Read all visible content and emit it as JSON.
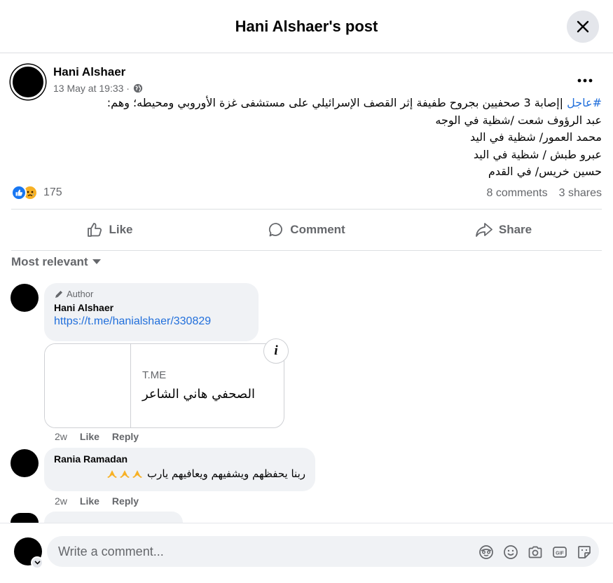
{
  "header": {
    "title": "Hani Alshaer's post"
  },
  "post": {
    "author": "Hani Alshaer",
    "timestamp": "13 May at 19:33 ·",
    "hashtag": "#عاجل",
    "line1": " |إصابة 3 صحفيين بجروح طفيفة إثر القصف الإسرائيلي على مستشفى غزة الأوروبي ومحيطه؛ وهم:",
    "line2": "عبد الرؤوف شعت /شظية في الوجه",
    "line3": "محمد العمور/ شظية في اليد",
    "line4": "عبرو طبش / شظية في اليد",
    "line5": "حسين خريس/ في القدم",
    "reaction_count": "175",
    "comments": "8 comments",
    "shares": "3 shares"
  },
  "actions": {
    "like": "Like",
    "comment": "Comment",
    "share": "Share"
  },
  "sort": {
    "label": "Most relevant"
  },
  "comments": [
    {
      "badge": "Author",
      "name": "Hani Alshaer",
      "link": "https://t.me/hanialshaer/330829",
      "card_domain": "T.ME",
      "card_title": "الصحفي هاني الشاعر",
      "time": "2w",
      "like": "Like",
      "reply": "Reply"
    },
    {
      "name": "Rania Ramadan",
      "text": "ربنا يحفظهم ويشفيهم ويعافيهم يارب",
      "time": "2w",
      "like": "Like",
      "reply": "Reply"
    }
  ],
  "composer": {
    "placeholder": "Write a comment..."
  },
  "colors": {
    "accent": "#1877f2",
    "link": "#216fdb",
    "secondary": "#65676b",
    "bubble": "#f0f2f5"
  },
  "icons": [
    "close-icon",
    "globe-icon",
    "more-icon",
    "like-reaction-icon",
    "sad-reaction-icon",
    "thumb-up-icon",
    "comment-icon",
    "share-icon",
    "caret-down-icon",
    "pencil-icon",
    "info-icon",
    "pray-hands-icon",
    "avatar-emoji-icon",
    "smiley-icon",
    "camera-icon",
    "gif-icon",
    "sticker-icon"
  ]
}
